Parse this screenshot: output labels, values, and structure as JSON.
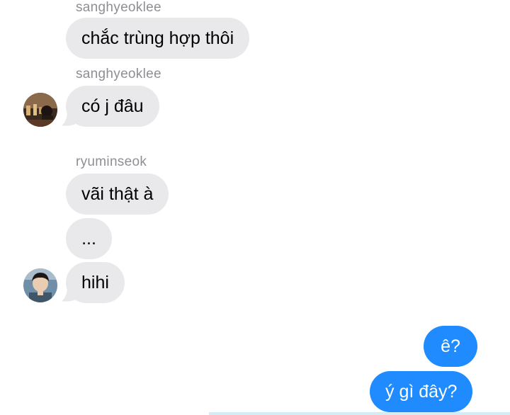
{
  "messages": [
    {
      "sender": "sanghyeoklee",
      "text": "chắc trùng hợp thôi"
    },
    {
      "sender": "sanghyeoklee",
      "text": "có j đâu"
    },
    {
      "sender": "ryuminseok",
      "text": "vãi thật à"
    },
    {
      "text": "..."
    },
    {
      "text": "hihi"
    },
    {
      "text": "ê?"
    },
    {
      "text": "ý gì đây?"
    }
  ],
  "colors": {
    "incoming_bubble": "#e9e9eb",
    "outgoing_bubble": "#1f8bff",
    "sender_name": "#8e8e93"
  }
}
